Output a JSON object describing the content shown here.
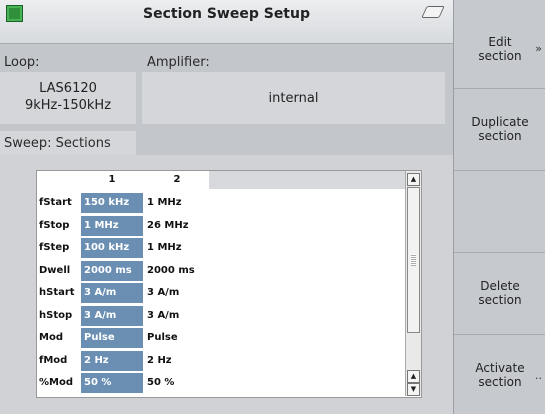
{
  "window": {
    "title": "Section Sweep Setup"
  },
  "loop": {
    "label": "Loop:",
    "value_line1": "LAS6120",
    "value_line2": "9kHz-150kHz"
  },
  "amplifier": {
    "label": "Amplifier:",
    "value": "internal"
  },
  "sweep": {
    "tab_label": "Sweep: Sections",
    "columns": [
      "1",
      "2"
    ],
    "rows": [
      {
        "name": "fStart",
        "c1": "150 kHz",
        "c2": "1 MHz"
      },
      {
        "name": "fStop",
        "c1": "1 MHz",
        "c2": "26 MHz"
      },
      {
        "name": "fStep",
        "c1": "100 kHz",
        "c2": "1 MHz"
      },
      {
        "name": "Dwell",
        "c1": "2000 ms",
        "c2": "2000 ms"
      },
      {
        "name": "hStart",
        "c1": "3 A/m",
        "c2": "3 A/m"
      },
      {
        "name": "hStop",
        "c1": "3 A/m",
        "c2": "3 A/m"
      },
      {
        "name": "Mod",
        "c1": "Pulse",
        "c2": "Pulse"
      },
      {
        "name": "fMod",
        "c1": "2 Hz",
        "c2": "2 Hz"
      },
      {
        "name": "%Mod",
        "c1": "50 %",
        "c2": "50 %"
      }
    ]
  },
  "sidebar": {
    "edit": {
      "line1": "Edit",
      "line2": "section",
      "arrow": "»"
    },
    "duplicate": {
      "line1": "Duplicate",
      "line2": "section"
    },
    "empty": {
      "line1": ""
    },
    "delete": {
      "line1": "Delete",
      "line2": "section"
    },
    "activate": {
      "line1": "Activate",
      "line2": "section",
      "arrow": ".."
    }
  },
  "colors": {
    "selected_column": "#6a8fb3",
    "status_led": "#2f8f3a"
  },
  "icons": {
    "status": "status-led-icon",
    "clear": "eraser-icon",
    "scroll_up": "arrow-up-icon",
    "scroll_down": "arrow-down-icon"
  }
}
